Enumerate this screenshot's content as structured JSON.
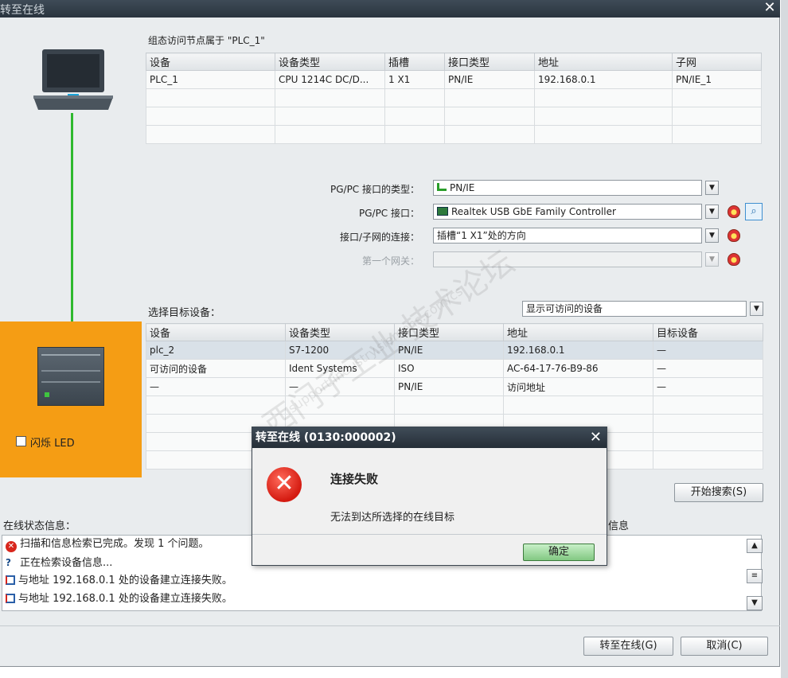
{
  "window": {
    "title": "转至在线",
    "close": "✕"
  },
  "config_table": {
    "caption": "组态访问节点属于 \"PLC_1\"",
    "headers": [
      "设备",
      "设备类型",
      "插槽",
      "接口类型",
      "地址",
      "子网"
    ],
    "rows": [
      [
        "PLC_1",
        "CPU 1214C DC/D...",
        "1 X1",
        "PN/IE",
        "192.168.0.1",
        "PN/IE_1"
      ]
    ]
  },
  "pgpc": {
    "type_label": "PG/PC 接口的类型：",
    "type_value": "PN/IE",
    "iface_label": "PG/PC 接口：",
    "iface_value": "Realtek USB GbE Family Controller",
    "conn_label": "接口/子网的连接：",
    "conn_value": "插槽“1 X1”处的方向",
    "gateway_label": "第一个网关：",
    "gateway_value": ""
  },
  "target": {
    "label": "选择目标设备：",
    "filter_value": "显示可访问的设备",
    "headers": [
      "设备",
      "设备类型",
      "接口类型",
      "地址",
      "目标设备"
    ],
    "rows": [
      [
        "plc_2",
        "S7-1200",
        "PN/IE",
        "192.168.0.1",
        "—"
      ],
      [
        "可访问的设备",
        "Ident Systems",
        "ISO",
        "AC-64-17-76-B9-86",
        "—"
      ],
      [
        "—",
        "—",
        "PN/IE",
        "访问地址",
        "—"
      ]
    ]
  },
  "flash_led": "闪烁 LED",
  "start_search": "开始搜索(S)",
  "status": {
    "label": "在线状态信息：",
    "right_label": "信息",
    "lines": [
      "扫描和信息检索已完成。发现 1 个问题。",
      "正在检索设备信息...",
      "与地址 192.168.0.1 处的设备建立连接失败。",
      "与地址 192.168.0.1 处的设备建立连接失败。"
    ]
  },
  "buttons": {
    "go_online": "转至在线(G)",
    "cancel": "取消(C)"
  },
  "dialog": {
    "title": "转至在线 (0130:000002)",
    "heading": "连接失败",
    "message": "无法到达所选择的在线目标",
    "ok": "确定"
  },
  "watermark": {
    "line1": "西门子工业 技术论坛",
    "line2": "support.industry.siemens.com/cs"
  },
  "colors": {
    "orange_panel": "#f59d14",
    "link_line": "#2eb82e",
    "error_red": "#d41a10"
  },
  "icons": [
    "laptop-icon",
    "plc-device-icon",
    "shield-icon",
    "scan-icon",
    "error-icon",
    "search-icon",
    "network-icon",
    "dropdown-arrow-icon"
  ]
}
